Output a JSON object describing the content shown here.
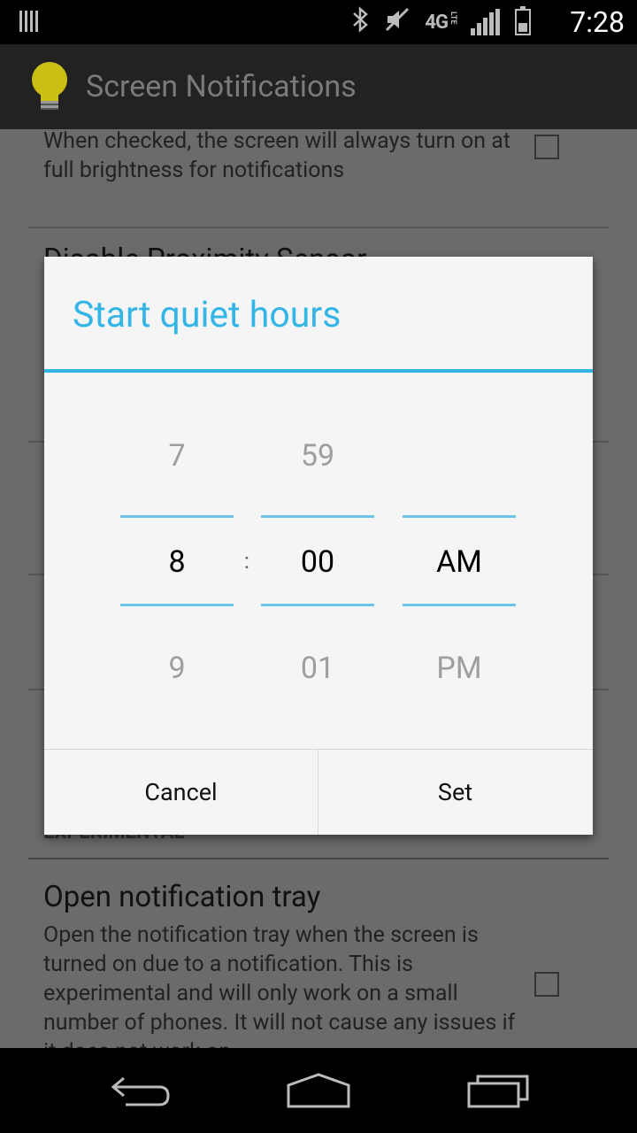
{
  "status_bar": {
    "time": "7:28",
    "network": "4G",
    "network_sub": "LTE",
    "icons": [
      "signal-bars-icon",
      "bluetooth-icon",
      "mute-icon",
      "signal-strength-icon",
      "battery-icon"
    ]
  },
  "action_bar": {
    "title": "Screen Notifications",
    "icon": "light-bulb-icon"
  },
  "preferences": [
    {
      "summary": "When checked, the screen will always turn on at full brightness for notifications",
      "checked": false
    },
    {
      "title": "Disable Proximity Sensor",
      "partial": true
    }
  ],
  "section_header": "EXPERIMENTAL",
  "experimental_pref": {
    "title": "Open notification tray",
    "summary": "Open the notification tray when the screen is turned on due to a notification. This is experimental and will only work on a small number of phones. It will not cause any issues if it does not work on",
    "checked": false
  },
  "dialog": {
    "title": "Start quiet hours",
    "hour": {
      "prev": "7",
      "current": "8",
      "next": "9"
    },
    "separator": ":",
    "minute": {
      "prev": "59",
      "current": "00",
      "next": "01"
    },
    "ampm": {
      "prev": "",
      "current": "AM",
      "next": "PM"
    },
    "cancel_label": "Cancel",
    "set_label": "Set"
  },
  "nav_bar": {
    "icons": [
      "back-icon",
      "home-icon",
      "recent-apps-icon"
    ]
  },
  "colors": {
    "accent": "#33b5e5",
    "picker_line": "#6cc5e8",
    "dialog_bg": "#f5f5f5",
    "bulb": "#cbbf16"
  }
}
